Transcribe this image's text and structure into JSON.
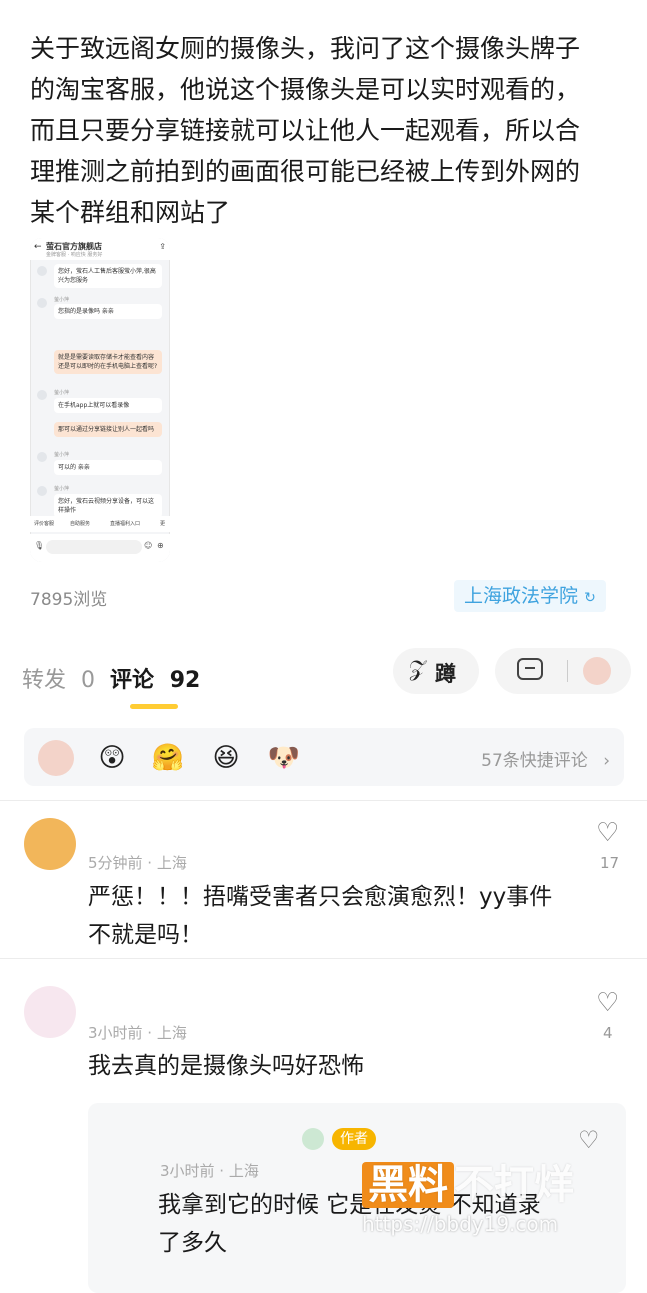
{
  "post": {
    "text": "关于致远阁女厕的摄像头，我问了这个摄像头牌子\n的淘宝客服，他说这个摄像头是可以实时观看的，\n而且只要分享链接就可以让他人一起观看，所以合\n理推测之前拍到的画面很可能已经被上传到外网的\n某个群组和网站了"
  },
  "screenshot": {
    "store_title": "萤石官方旗舰店",
    "store_sub": "金牌客服 · 响应快 服务好",
    "bubbles": [
      {
        "text": "您好，萤石人工售后客服萤小萍,很高兴为您服务",
        "style": "w"
      },
      {
        "text": "您指的是录像吗 亲亲",
        "style": "w"
      },
      {
        "text": "就是是需要读取存储卡才能查看内容还是可以即时的在手机电脑上查看呢?",
        "style": "o"
      },
      {
        "text": "在手机app上就可以看录像",
        "style": "w"
      },
      {
        "text": "那可以通过分享链接让别人一起看吗",
        "style": "o"
      },
      {
        "text": "可以的 亲亲",
        "style": "w"
      },
      {
        "text": "您好，萤石云视频分享设备，可以这样操作",
        "style": "w"
      }
    ],
    "agent_name": "萤小萍",
    "quick_actions": [
      "评价客服",
      "自助服务",
      "直播福利入口",
      "更"
    ]
  },
  "meta": {
    "views": "7895浏览",
    "school_tag": "上海政法学院"
  },
  "tabs": {
    "forward_label": "转发",
    "forward_count": "0",
    "comment_label": "评论",
    "comment_count": "92"
  },
  "actions": {
    "like_label": "蹲"
  },
  "quick_comments": {
    "label": "57条快捷评论"
  },
  "comments": [
    {
      "meta": "5分钟前 · 上海",
      "likes": "17",
      "text": "严惩！！！捂嘴受害者只会愈演愈烈！yy事件\n不就是吗！"
    },
    {
      "meta": "3小时前 · 上海",
      "likes": "4",
      "text": "我去真的是摄像头吗好恐怖",
      "reply": {
        "badge": "作者",
        "meta": "3小时前 · 上海",
        "text": "我拿到它的时候 它是在发烫 不知道录\n了多久"
      }
    }
  ],
  "watermark": {
    "brand_a": "黑料",
    "brand_b": "不打烊",
    "url": "https://bbdy19.com"
  },
  "colors": {
    "accent_yellow": "#ffcc33",
    "tag_blue": "#3fa3df",
    "badge_orange": "#f7b500"
  }
}
